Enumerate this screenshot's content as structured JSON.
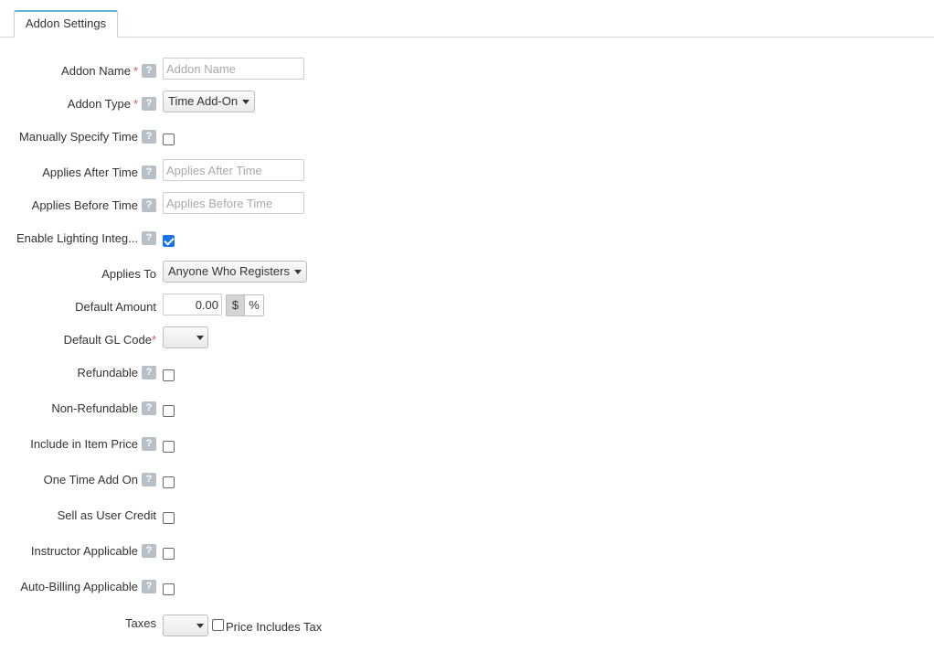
{
  "tabs": [
    {
      "label": "Addon Settings"
    }
  ],
  "form": {
    "addon_name": {
      "label": "Addon Name",
      "required": "*",
      "help": "?",
      "placeholder": "Addon Name",
      "value": ""
    },
    "addon_type": {
      "label": "Addon Type",
      "required": "*",
      "help": "?",
      "selected": "Time Add-On"
    },
    "manually_specify_time": {
      "label": "Manually Specify Time",
      "help": "?",
      "checked": false
    },
    "applies_after_time": {
      "label": "Applies After Time",
      "help": "?",
      "placeholder": "Applies After Time",
      "value": ""
    },
    "applies_before_time": {
      "label": "Applies Before Time",
      "help": "?",
      "placeholder": "Applies Before Time",
      "value": ""
    },
    "enable_lighting": {
      "label": "Enable Lighting Integ...",
      "help": "?",
      "checked": true
    },
    "applies_to": {
      "label": "Applies To",
      "selected": "Anyone Who Registers"
    },
    "default_amount": {
      "label": "Default Amount",
      "value": "0.00",
      "currency_symbol": "$",
      "percent_symbol": "%"
    },
    "default_gl_code": {
      "label": "Default GL Code",
      "required": "*",
      "selected": ""
    },
    "refundable": {
      "label": "Refundable",
      "help": "?",
      "checked": false
    },
    "non_refundable": {
      "label": "Non-Refundable",
      "help": "?",
      "checked": false
    },
    "include_in_item_price": {
      "label": "Include in Item Price",
      "help": "?",
      "checked": false
    },
    "one_time_add_on": {
      "label": "One Time Add On",
      "help": "?",
      "checked": false
    },
    "sell_as_user_credit": {
      "label": "Sell as User Credit",
      "checked": false
    },
    "instructor_applicable": {
      "label": "Instructor Applicable",
      "help": "?",
      "checked": false
    },
    "auto_billing_applicable": {
      "label": "Auto-Billing Applicable",
      "help": "?",
      "checked": false
    },
    "taxes": {
      "label": "Taxes",
      "selected": "",
      "price_includes_tax_label": "Price Includes Tax",
      "price_includes_tax_checked": false
    }
  },
  "colors": {
    "accent": "#5bb4d4",
    "required": "#d9534f",
    "help_badge": "#b7c0c7",
    "checkbox_checked": "#1a73e8"
  }
}
